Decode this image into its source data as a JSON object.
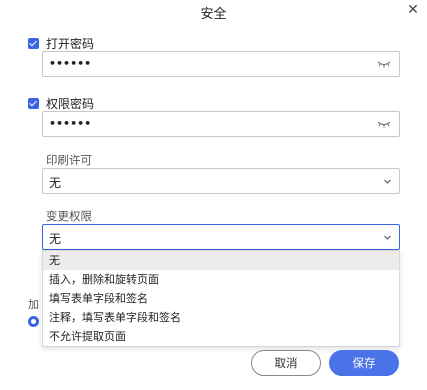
{
  "dialog": {
    "title": "安全",
    "close_label": "✕"
  },
  "open_password": {
    "label": "打开密码",
    "checked": true,
    "value": "••••••"
  },
  "permission_password": {
    "label": "权限密码",
    "checked": true,
    "value": "••••••"
  },
  "print_permission": {
    "label": "印刷许可",
    "value": "无"
  },
  "change_permission": {
    "label": "变更权限",
    "value": "无",
    "options": [
      "无",
      "插入，删除和旋转页面",
      "填写表单字段和签名",
      "注释，填写表单字段和签名",
      "不允许提取页面"
    ]
  },
  "encryption": {
    "label": "加"
  },
  "buttons": {
    "cancel": "取消",
    "save": "保存"
  },
  "colors": {
    "accent": "#3b64e0",
    "save_bg": "#4a73e8"
  }
}
